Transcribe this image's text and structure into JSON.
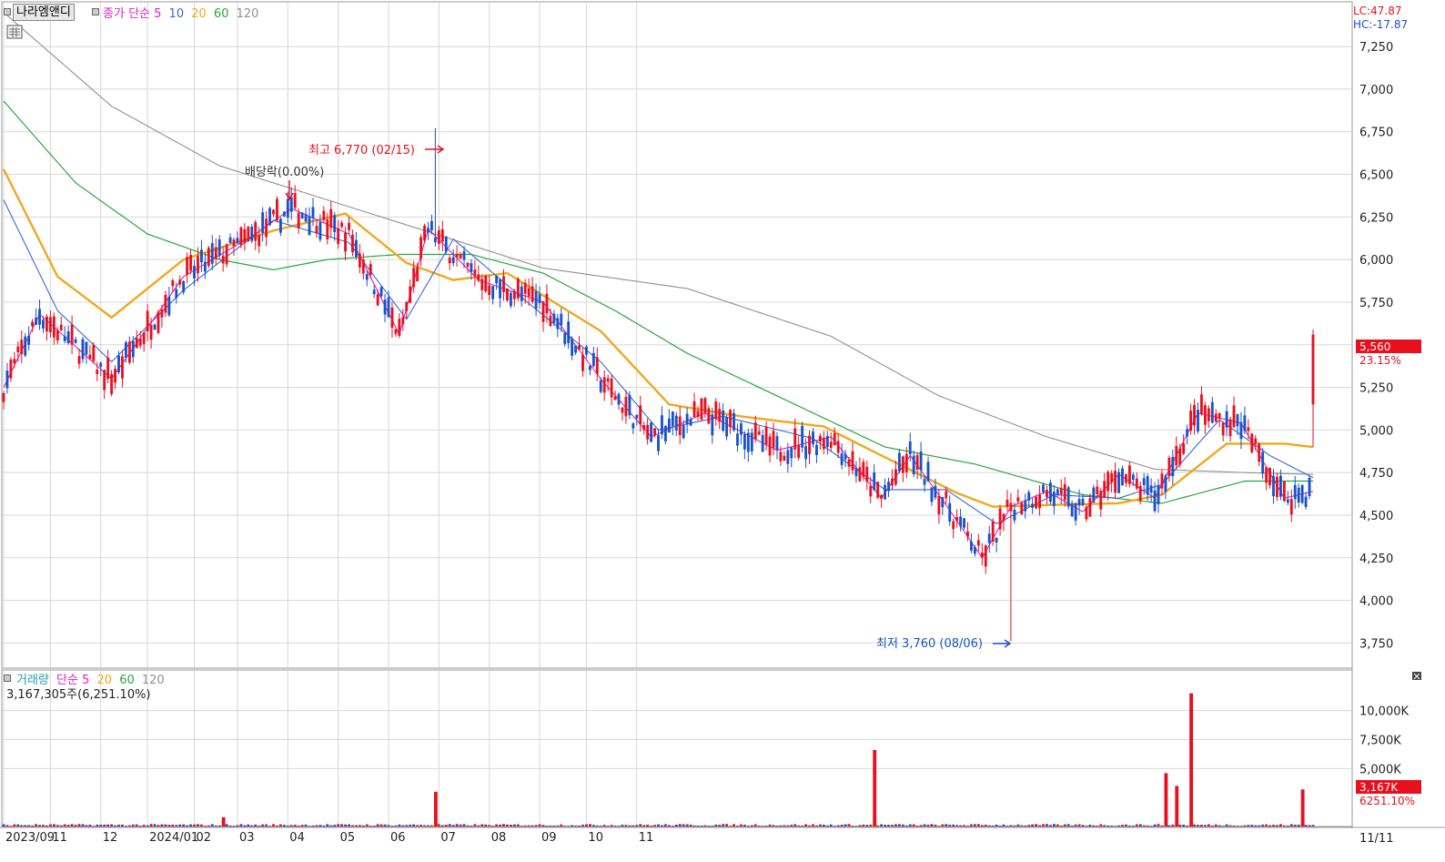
{
  "header": {
    "stock_name": "나라엠앤디",
    "price_line_label": "종가",
    "ma_type": "단순",
    "ma_periods": [
      "5",
      "10",
      "20",
      "60",
      "120"
    ],
    "lc": "LC:47.87",
    "hc": "HC:-17.87"
  },
  "volume_header": {
    "label": "거래량",
    "ma_type": "단순",
    "ma_periods": [
      "5",
      "20",
      "60",
      "120"
    ],
    "summary": "3,167,305주(6,251.10%)"
  },
  "annotations": {
    "high": "최고 6,770 (02/15)",
    "low": "최저 3,760 (08/06)",
    "dividend": "배당락(0.00%)"
  },
  "price_tag": {
    "value": "5,560",
    "change": "23.15%"
  },
  "volume_tag": {
    "value": "3,167K",
    "change": "6251.10%"
  },
  "x_axis": {
    "labels": [
      "2023/09",
      "11",
      "12",
      "2024/01",
      "02",
      "03",
      "04",
      "05",
      "06",
      "07",
      "08",
      "09",
      "10",
      "11"
    ],
    "right_label": "11/11"
  },
  "colors": {
    "up": "#e8101e",
    "down": "#1852c8",
    "ma5": "#e020c8",
    "ma10": "#3a66e0",
    "ma20": "#f0a81e",
    "ma60": "#28a83c",
    "ma120": "#909090",
    "grid": "#d8d8d8"
  },
  "chart_data": [
    {
      "type": "candlestick",
      "title": "",
      "y_ticks": [
        3750,
        4000,
        4250,
        4500,
        4750,
        5000,
        5250,
        5500,
        5750,
        6000,
        6250,
        6500,
        6750,
        7000,
        7250
      ],
      "ylim": [
        3640,
        7475
      ],
      "months": [
        "2023/09",
        "11",
        "12",
        "2024/01",
        "02",
        "03",
        "04",
        "05",
        "06",
        "07",
        "08",
        "09",
        "10",
        "11"
      ],
      "high": {
        "date": "02/15",
        "value": 6770
      },
      "low": {
        "date": "08/06",
        "value": 3760
      },
      "last_close": 5560,
      "last_change_pct": 23.15,
      "series": [
        {
          "name": "5",
          "anchors": [
            [
              0,
              5250
            ],
            [
              10,
              5680
            ],
            [
              30,
              5300
            ],
            [
              50,
              5900
            ],
            [
              70,
              6150
            ],
            [
              80,
              6300
            ],
            [
              96,
              6150
            ],
            [
              110,
              5560
            ],
            [
              118,
              6180
            ],
            [
              132,
              5880
            ],
            [
              150,
              5750
            ],
            [
              166,
              5300
            ],
            [
              180,
              4960
            ],
            [
              195,
              5100
            ],
            [
              215,
              4880
            ],
            [
              230,
              4960
            ],
            [
              244,
              4600
            ],
            [
              252,
              4850
            ],
            [
              262,
              4560
            ],
            [
              272,
              4250
            ],
            [
              280,
              4550
            ],
            [
              290,
              4640
            ],
            [
              300,
              4520
            ],
            [
              310,
              4740
            ],
            [
              320,
              4600
            ],
            [
              332,
              5100
            ],
            [
              344,
              5040
            ],
            [
              356,
              4600
            ],
            [
              364,
              4640
            ]
          ]
        },
        {
          "name": "10",
          "anchors": [
            [
              0,
              6350
            ],
            [
              15,
              5700
            ],
            [
              30,
              5400
            ],
            [
              50,
              5820
            ],
            [
              75,
              6230
            ],
            [
              96,
              6100
            ],
            [
              112,
              5650
            ],
            [
              125,
              6120
            ],
            [
              145,
              5760
            ],
            [
              166,
              5400
            ],
            [
              182,
              5000
            ],
            [
              200,
              5080
            ],
            [
              225,
              4950
            ],
            [
              245,
              4650
            ],
            [
              262,
              4650
            ],
            [
              276,
              4450
            ],
            [
              292,
              4620
            ],
            [
              310,
              4600
            ],
            [
              322,
              4680
            ],
            [
              338,
              5060
            ],
            [
              352,
              4850
            ],
            [
              364,
              4720
            ]
          ]
        },
        {
          "name": "20",
          "anchors": [
            [
              0,
              6530
            ],
            [
              15,
              5900
            ],
            [
              30,
              5660
            ],
            [
              50,
              6000
            ],
            [
              75,
              6170
            ],
            [
              95,
              6270
            ],
            [
              112,
              5980
            ],
            [
              125,
              5880
            ],
            [
              140,
              5920
            ],
            [
              166,
              5580
            ],
            [
              185,
              5150
            ],
            [
              205,
              5080
            ],
            [
              228,
              5020
            ],
            [
              245,
              4840
            ],
            [
              265,
              4630
            ],
            [
              275,
              4550
            ],
            [
              290,
              4560
            ],
            [
              310,
              4570
            ],
            [
              322,
              4620
            ],
            [
              340,
              4920
            ],
            [
              356,
              4920
            ],
            [
              364,
              4900
            ]
          ]
        },
        {
          "name": "60",
          "anchors": [
            [
              0,
              6930
            ],
            [
              20,
              6450
            ],
            [
              40,
              6150
            ],
            [
              60,
              6000
            ],
            [
              75,
              5940
            ],
            [
              90,
              6000
            ],
            [
              110,
              6030
            ],
            [
              130,
              6030
            ],
            [
              150,
              5920
            ],
            [
              170,
              5700
            ],
            [
              190,
              5450
            ],
            [
              220,
              5150
            ],
            [
              245,
              4900
            ],
            [
              270,
              4800
            ],
            [
              300,
              4620
            ],
            [
              322,
              4570
            ],
            [
              345,
              4700
            ],
            [
              364,
              4700
            ]
          ]
        },
        {
          "name": "120",
          "anchors": [
            [
              0,
              7450
            ],
            [
              30,
              6900
            ],
            [
              60,
              6550
            ],
            [
              90,
              6350
            ],
            [
              120,
              6150
            ],
            [
              150,
              5950
            ],
            [
              190,
              5830
            ],
            [
              230,
              5550
            ],
            [
              260,
              5200
            ],
            [
              290,
              4960
            ],
            [
              320,
              4770
            ],
            [
              345,
              4750
            ],
            [
              364,
              4740
            ]
          ]
        }
      ]
    },
    {
      "type": "bar",
      "title": "",
      "y_ticks": [
        5000,
        7500,
        10000
      ],
      "y_unit": "K",
      "ylim": [
        0,
        12800
      ],
      "last_volume": 3167305,
      "last_volume_pct": 6251.1,
      "spikes": [
        [
          61,
          800
        ],
        [
          120,
          3000
        ],
        [
          242,
          6600
        ],
        [
          323,
          4600
        ],
        [
          326,
          3500
        ],
        [
          330,
          11500
        ],
        [
          361,
          3200
        ]
      ]
    }
  ]
}
